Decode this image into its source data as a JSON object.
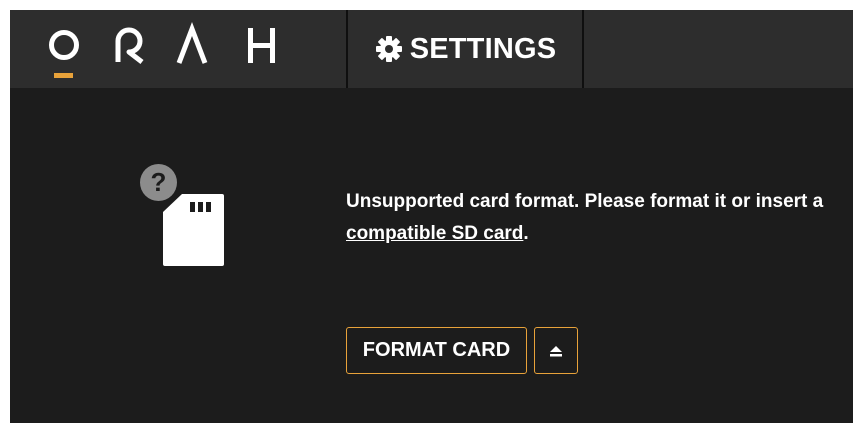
{
  "header": {
    "logo_text": "ORAH",
    "settings_tab": {
      "label": "SETTINGS",
      "icon": "gear-icon"
    }
  },
  "main": {
    "illustration": {
      "card_icon": "sd-card-icon",
      "badge_icon": "question-mark-icon",
      "badge_text": "?"
    },
    "message": {
      "before_link": "Unsupported card format. Please format it or insert a ",
      "link_text": "compatible SD card",
      "after_link": "."
    },
    "buttons": {
      "format_label": "FORMAT CARD",
      "eject_icon": "eject-icon"
    }
  },
  "colors": {
    "background": "#1c1c1c",
    "header_background": "#2d2d2d",
    "accent": "#e8a23a",
    "text": "#ffffff",
    "badge": "#8c8c8c"
  }
}
